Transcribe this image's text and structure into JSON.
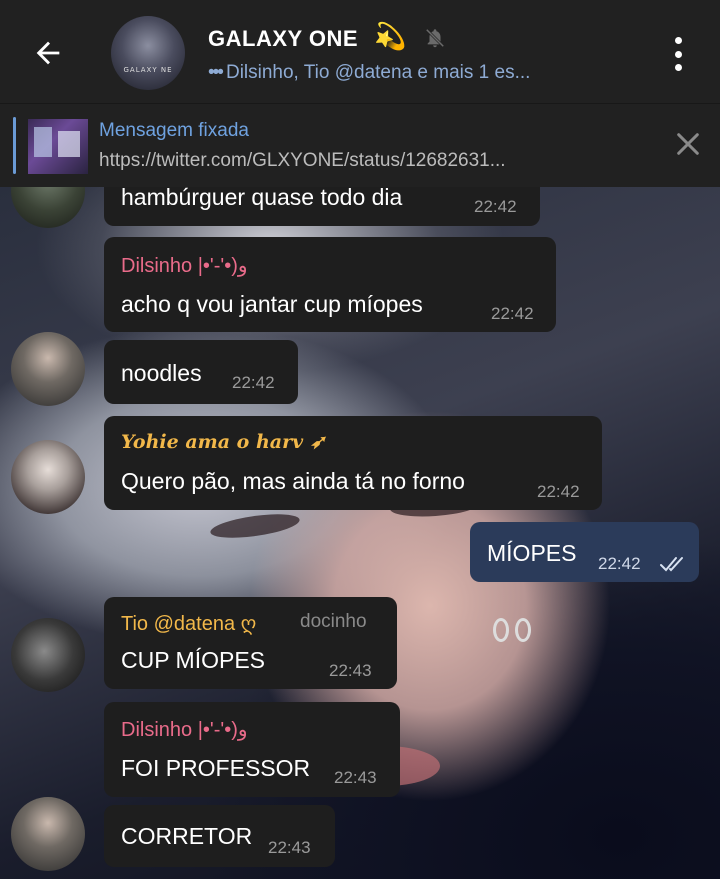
{
  "header": {
    "title": "GALAXY ONE",
    "title_emoji": "💫",
    "avatar_text": "GALAXY NE",
    "subtitle_dots": "•••",
    "subtitle": "Dilsinho, Tio @datena e mais 1 es...",
    "icons": [
      "back-arrow-icon",
      "mute-icon",
      "more-vert-icon"
    ]
  },
  "pinned": {
    "label": "Mensagem fixada",
    "text": "https://twitter.com/GLXYONE/status/12682631..."
  },
  "messages": [
    {
      "text": "hambúrguer quase todo dia",
      "time": "22:42"
    },
    {
      "sender": "Dilsinho |•'-'•)و",
      "text": "acho q vou jantar cup míopes",
      "time": "22:42"
    },
    {
      "text": "noodles",
      "time": "22:42"
    },
    {
      "sender": "Yohie ama o harv ➶",
      "text": "Quero pão, mas ainda tá no forno",
      "time": "22:42"
    },
    {
      "text": "MÍOPES",
      "time": "22:42",
      "outgoing": true
    },
    {
      "sender": "Tio @datena ღ",
      "admin_tag": "docinho",
      "text": "CUP MÍOPES",
      "time": "22:43"
    },
    {
      "sender": "Dilsinho |•'-'•)و",
      "text": "FOI PROFESSOR",
      "time": "22:43"
    },
    {
      "text": "CORRETOR",
      "time": "22:43"
    }
  ],
  "colors": {
    "header_bg": "#212121",
    "incoming_bubble": "#1e1e1e",
    "outgoing_bubble": "#2b3b5a",
    "accent_blue": "#6fa2e0",
    "sender_pink": "#e96b8a",
    "sender_gold": "#f2b84a"
  }
}
